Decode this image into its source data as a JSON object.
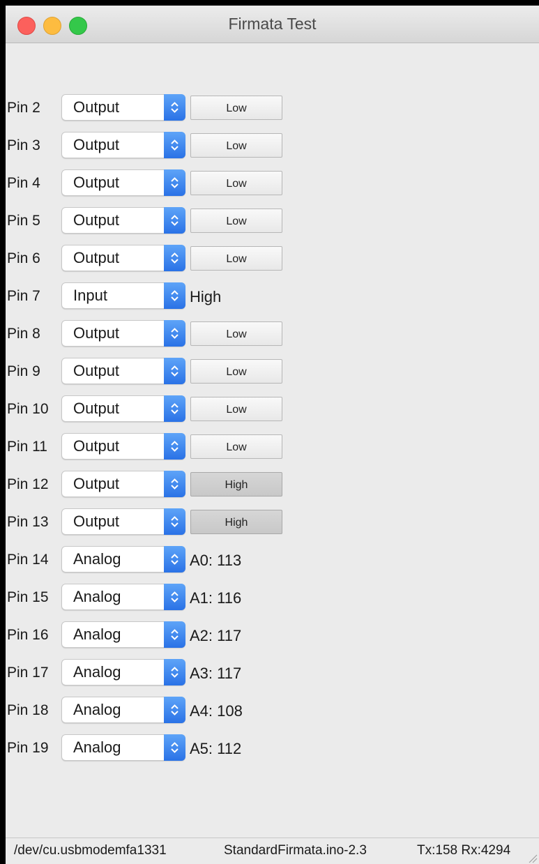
{
  "window": {
    "title": "Firmata Test"
  },
  "pins": [
    {
      "label": "Pin 2",
      "mode": "Output",
      "control": "button",
      "value": "Low"
    },
    {
      "label": "Pin 3",
      "mode": "Output",
      "control": "button",
      "value": "Low"
    },
    {
      "label": "Pin 4",
      "mode": "Output",
      "control": "button",
      "value": "Low"
    },
    {
      "label": "Pin 5",
      "mode": "Output",
      "control": "button",
      "value": "Low"
    },
    {
      "label": "Pin 6",
      "mode": "Output",
      "control": "button",
      "value": "Low"
    },
    {
      "label": "Pin 7",
      "mode": "Input",
      "control": "text",
      "value": "High"
    },
    {
      "label": "Pin 8",
      "mode": "Output",
      "control": "button",
      "value": "Low"
    },
    {
      "label": "Pin 9",
      "mode": "Output",
      "control": "button",
      "value": "Low"
    },
    {
      "label": "Pin 10",
      "mode": "Output",
      "control": "button",
      "value": "Low"
    },
    {
      "label": "Pin 11",
      "mode": "Output",
      "control": "button",
      "value": "Low"
    },
    {
      "label": "Pin 12",
      "mode": "Output",
      "control": "button",
      "value": "High"
    },
    {
      "label": "Pin 13",
      "mode": "Output",
      "control": "button",
      "value": "High"
    },
    {
      "label": "Pin 14",
      "mode": "Analog",
      "control": "text",
      "value": "A0: 113"
    },
    {
      "label": "Pin 15",
      "mode": "Analog",
      "control": "text",
      "value": "A1: 116"
    },
    {
      "label": "Pin 16",
      "mode": "Analog",
      "control": "text",
      "value": "A2: 117"
    },
    {
      "label": "Pin 17",
      "mode": "Analog",
      "control": "text",
      "value": "A3: 117"
    },
    {
      "label": "Pin 18",
      "mode": "Analog",
      "control": "text",
      "value": "A4: 108"
    },
    {
      "label": "Pin 19",
      "mode": "Analog",
      "control": "text",
      "value": "A5: 112"
    }
  ],
  "status": {
    "port": "/dev/cu.usbmodemfa1331",
    "firmware": "StandardFirmata.ino-2.3",
    "traffic": "Tx:158 Rx:4294"
  },
  "colors": {
    "stepper_top": "#5ea4f8",
    "stepper_bottom": "#2a72e6",
    "close": "#fc605c",
    "minimize": "#fdbc40",
    "maximize": "#34c84a"
  },
  "icons": {
    "stepper": "up-down-chevron-icon",
    "resize": "resize-grip-icon"
  }
}
